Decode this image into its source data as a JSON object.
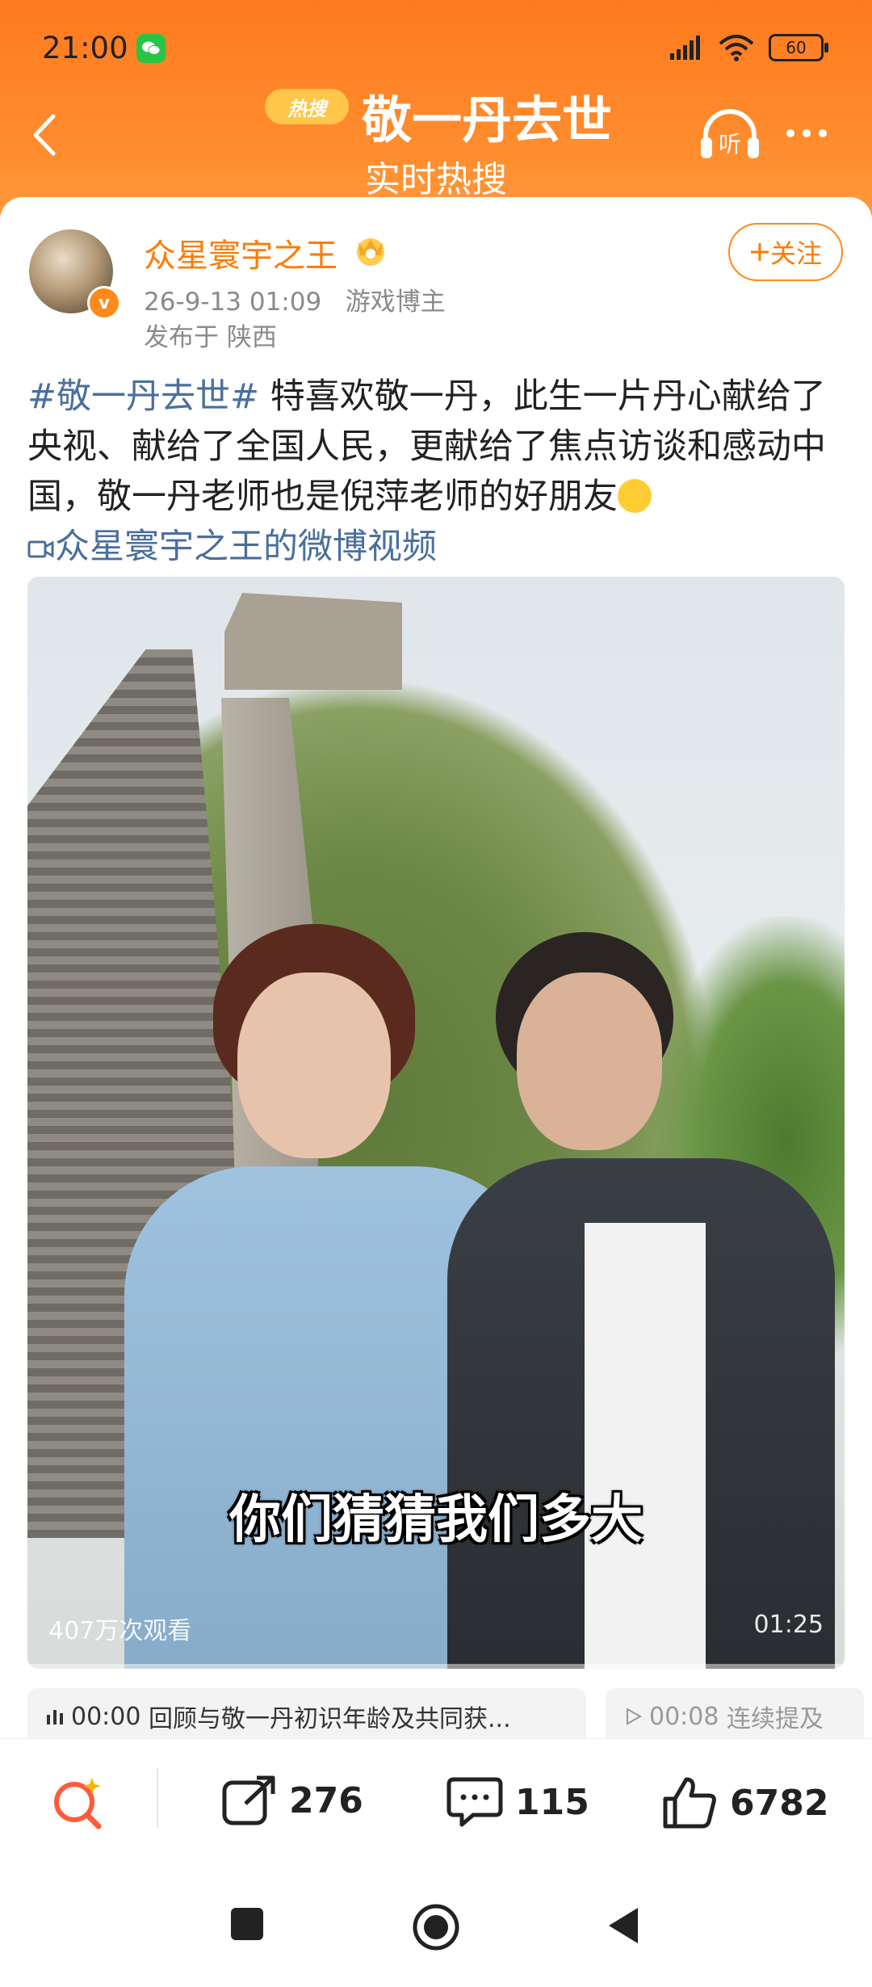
{
  "status_bar": {
    "time": "21:00",
    "battery": "60"
  },
  "header": {
    "hot_badge": "热搜",
    "title": "敬一丹去世",
    "subtitle": "实时热搜",
    "listen_label": "听"
  },
  "post": {
    "author": "众星寰宇之王",
    "time": "26-9-13 01:09",
    "source": "游戏博主",
    "location": "发布于 陕西",
    "follow_label": "关注",
    "hashtag": "#敬一丹去世#",
    "text": " 特喜欢敬一丹，此生一片丹心献给了央视、献给了全国人民，更献给了焦点访谈和感动中国，敬一丹老师也是倪萍老师的好朋友",
    "video_link": "众星寰宇之王的微博视频"
  },
  "video": {
    "subtitle": "你们猜猜我们多大",
    "views": "407万次观看",
    "duration": "01:25"
  },
  "chapters": [
    {
      "time": "00:00",
      "title": "回顾与敬一丹初识年龄及共同获..."
    },
    {
      "time": "00:08",
      "title": "连续提及"
    }
  ],
  "actions": {
    "share_count": "276",
    "comment_count": "115",
    "like_count": "6782"
  },
  "colors": {
    "brand_orange": "#ff7a1f",
    "link_blue": "#4a6f9c"
  }
}
